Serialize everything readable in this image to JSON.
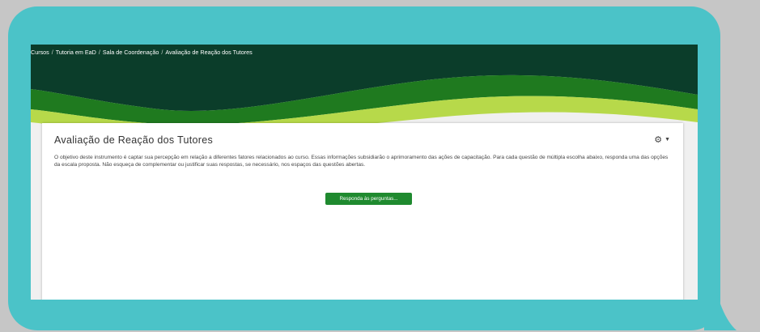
{
  "breadcrumb": {
    "items": [
      "Cursos",
      "Tutoria em EaD",
      "Sala de Coordenação",
      "Avaliação de Reação dos Tutores"
    ],
    "separator": "/"
  },
  "page": {
    "title": "Avaliação de Reação dos Tutores",
    "description": "O objetivo deste instrumento é captar sua percepção em relação a diferentes fatores relacionados ao curso. Essas informações subsidiarão o aprimoramento das ações de capacitação. Para cada questão de múltipla escolha abaixo, responda uma das opções da escala proposta. Não esqueça de complementar ou justificar suas respostas, se necessário, nos espaços das questões abertas.",
    "answer_button": "Responda às perguntas..."
  },
  "icons": {
    "settings": "gear-icon",
    "settings_menu": "caret-down-icon"
  },
  "colors": {
    "bubble": "#4bc3c8",
    "header_dark": "#0b3d2a",
    "header_green": "#1f7a1f",
    "header_lime": "#b7d94a",
    "button": "#1f8a2f"
  }
}
